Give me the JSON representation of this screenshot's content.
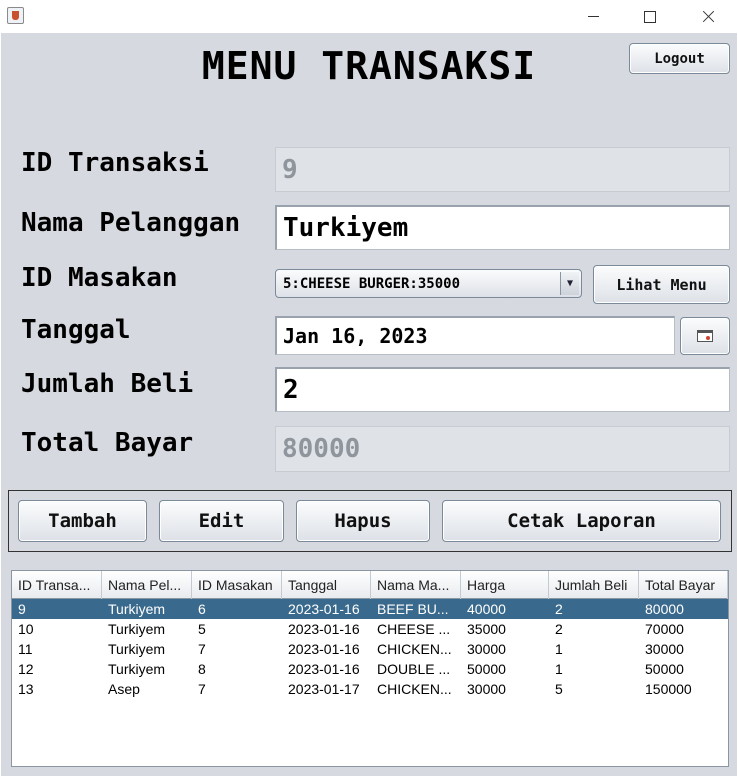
{
  "window": {
    "icon": "java-cup-icon"
  },
  "header": {
    "logout_label": "Logout",
    "title": "MENU TRANSAKSI"
  },
  "form": {
    "id_transaksi": {
      "label": "ID Transaksi",
      "value": "9"
    },
    "nama_pelanggan": {
      "label": "Nama Pelanggan",
      "value": "Turkiyem"
    },
    "id_masakan": {
      "label": "ID Masakan",
      "selected": "5:CHEESE BURGER:35000"
    },
    "lihat_menu_label": "Lihat Menu",
    "tanggal": {
      "label": "Tanggal",
      "value": "Jan 16, 2023"
    },
    "jumlah_beli": {
      "label": "Jumlah Beli",
      "value": "2"
    },
    "total_bayar": {
      "label": "Total Bayar",
      "value": "80000"
    }
  },
  "actions": {
    "tambah": "Tambah",
    "edit": "Edit",
    "hapus": "Hapus",
    "cetak": "Cetak Laporan"
  },
  "table": {
    "columns": [
      "ID Transa...",
      "Nama Pel...",
      "ID Masakan",
      "Tanggal",
      "Nama Ma...",
      "Harga",
      "Jumlah Beli",
      "Total Bayar"
    ],
    "selected_row": 0,
    "rows": [
      [
        "9",
        "Turkiyem",
        "6",
        "2023-01-16",
        "BEEF BU...",
        "40000",
        "2",
        "80000"
      ],
      [
        "10",
        "Turkiyem",
        "5",
        "2023-01-16",
        "CHEESE ...",
        "35000",
        "2",
        "70000"
      ],
      [
        "11",
        "Turkiyem",
        "7",
        "2023-01-16",
        "CHICKEN...",
        "30000",
        "1",
        "30000"
      ],
      [
        "12",
        "Turkiyem",
        "8",
        "2023-01-16",
        "DOUBLE ...",
        "50000",
        "1",
        "50000"
      ],
      [
        "13",
        "Asep",
        "7",
        "2023-01-17",
        "CHICKEN...",
        "30000",
        "5",
        "150000"
      ]
    ]
  },
  "colors": {
    "background": "#d6d9df",
    "selection": "#39698c"
  }
}
